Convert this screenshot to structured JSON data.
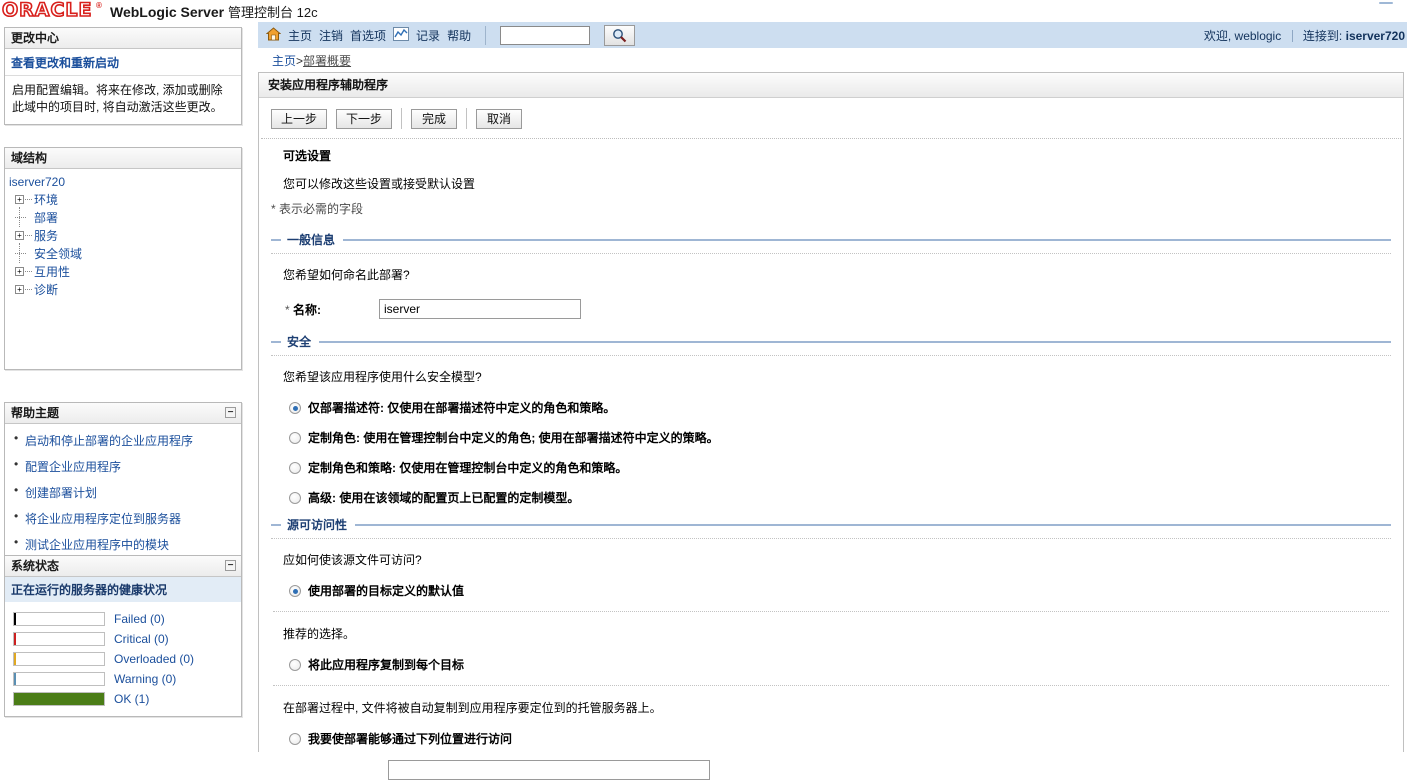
{
  "brand": {
    "logo": "ORACLE",
    "trademark": "®",
    "product": "WebLogic Server",
    "product_sub": "管理控制台 12c"
  },
  "navbar": {
    "home_icon": "home-icon",
    "chart_icon": "record-chart-icon",
    "links": [
      {
        "label": "主页",
        "name": "nav-home"
      },
      {
        "label": "注销",
        "name": "nav-logout"
      },
      {
        "label": "首选项",
        "name": "nav-preferences"
      },
      {
        "label": "记录",
        "name": "nav-record"
      },
      {
        "label": "帮助",
        "name": "nav-help"
      }
    ],
    "search_value": "",
    "search_placeholder": "",
    "search_icon": "search-icon",
    "welcome": "欢迎, weblogic",
    "connected_label": "连接到:",
    "connected_value": "iserver720"
  },
  "breadcrumb": {
    "home": "主页",
    "separator": ">",
    "current": "部署概要"
  },
  "change_center": {
    "title": "更改中心",
    "link": "查看更改和重新启动",
    "description": "启用配置编辑。将来在修改, 添加或删除此域中的项目时, 将自动激活这些更改。"
  },
  "domain_structure": {
    "title": "域结构",
    "root": "iserver720",
    "items": [
      {
        "label": "环境",
        "expandable": true
      },
      {
        "label": "部署",
        "expandable": false
      },
      {
        "label": "服务",
        "expandable": true
      },
      {
        "label": "安全领域",
        "expandable": false
      },
      {
        "label": "互用性",
        "expandable": true
      },
      {
        "label": "诊断",
        "expandable": true
      }
    ]
  },
  "help_topics": {
    "title": "帮助主题",
    "collapse_glyph": "−",
    "items": [
      "启动和停止部署的企业应用程序",
      "配置企业应用程序",
      "创建部署计划",
      "将企业应用程序定位到服务器",
      "测试企业应用程序中的模块"
    ]
  },
  "system_status": {
    "title": "系统状态",
    "collapse_glyph": "−",
    "subtitle": "正在运行的服务器的健康状况",
    "rows": [
      {
        "label": "Failed (0)",
        "color": "#000000",
        "fill_percent": 2
      },
      {
        "label": "Critical (0)",
        "color": "#cc2020",
        "fill_percent": 2
      },
      {
        "label": "Overloaded (0)",
        "color": "#e0a822",
        "fill_percent": 2
      },
      {
        "label": "Warning (0)",
        "color": "#5a8fb3",
        "fill_percent": 2
      },
      {
        "label": "OK (1)",
        "color": "#4b7d17",
        "fill_percent": 100
      }
    ]
  },
  "content": {
    "title": "安装应用程序辅助程序",
    "buttons": [
      {
        "label": "上一步",
        "name": "back-button"
      },
      {
        "label": "下一步",
        "name": "next-button"
      },
      {
        "label": "完成",
        "name": "finish-button"
      },
      {
        "label": "取消",
        "name": "cancel-button"
      }
    ],
    "optional_heading": "可选设置",
    "optional_sub": "您可以修改这些设置或接受默认设置",
    "required_note": "* 表示必需的字段",
    "general": {
      "section_title": "一般信息",
      "question": "您希望如何命名此部署?",
      "name_label_star": "*",
      "name_label": "名称:",
      "name_value": "iserver",
      "name_placeholder": ""
    },
    "security": {
      "section_title": "安全",
      "question": "您希望该应用程序使用什么安全模型?",
      "options": [
        {
          "label": "仅部署描述符: 仅使用在部署描述符中定义的角色和策略。",
          "selected": true
        },
        {
          "label": "定制角色: 使用在管理控制台中定义的角色; 使用在部署描述符中定义的策略。",
          "selected": false
        },
        {
          "label": "定制角色和策略: 仅使用在管理控制台中定义的角色和策略。",
          "selected": false
        },
        {
          "label": "高级: 使用在该领域的配置页上已配置的定制模型。",
          "selected": false
        }
      ]
    },
    "source_accessibility": {
      "section_title": "源可访问性",
      "question": "应如何使该源文件可访问?",
      "options": [
        {
          "label": "使用部署的目标定义的默认值",
          "selected": true,
          "note": "推荐的选择。"
        },
        {
          "label": "将此应用程序复制到每个目标",
          "selected": false,
          "note": "在部署过程中, 文件将被自动复制到应用程序要定位到的托管服务器上。"
        },
        {
          "label": "我要使部署能够通过下列位置进行访问",
          "selected": false,
          "note": "",
          "input_value": ""
        }
      ]
    }
  },
  "colors": {
    "brand_red": "#d8201c",
    "nav_blue": "#cddef0",
    "section_blue": "#1d3f73",
    "link_blue": "#1b4f9c",
    "subhead_blue": "#e2ecf6"
  }
}
